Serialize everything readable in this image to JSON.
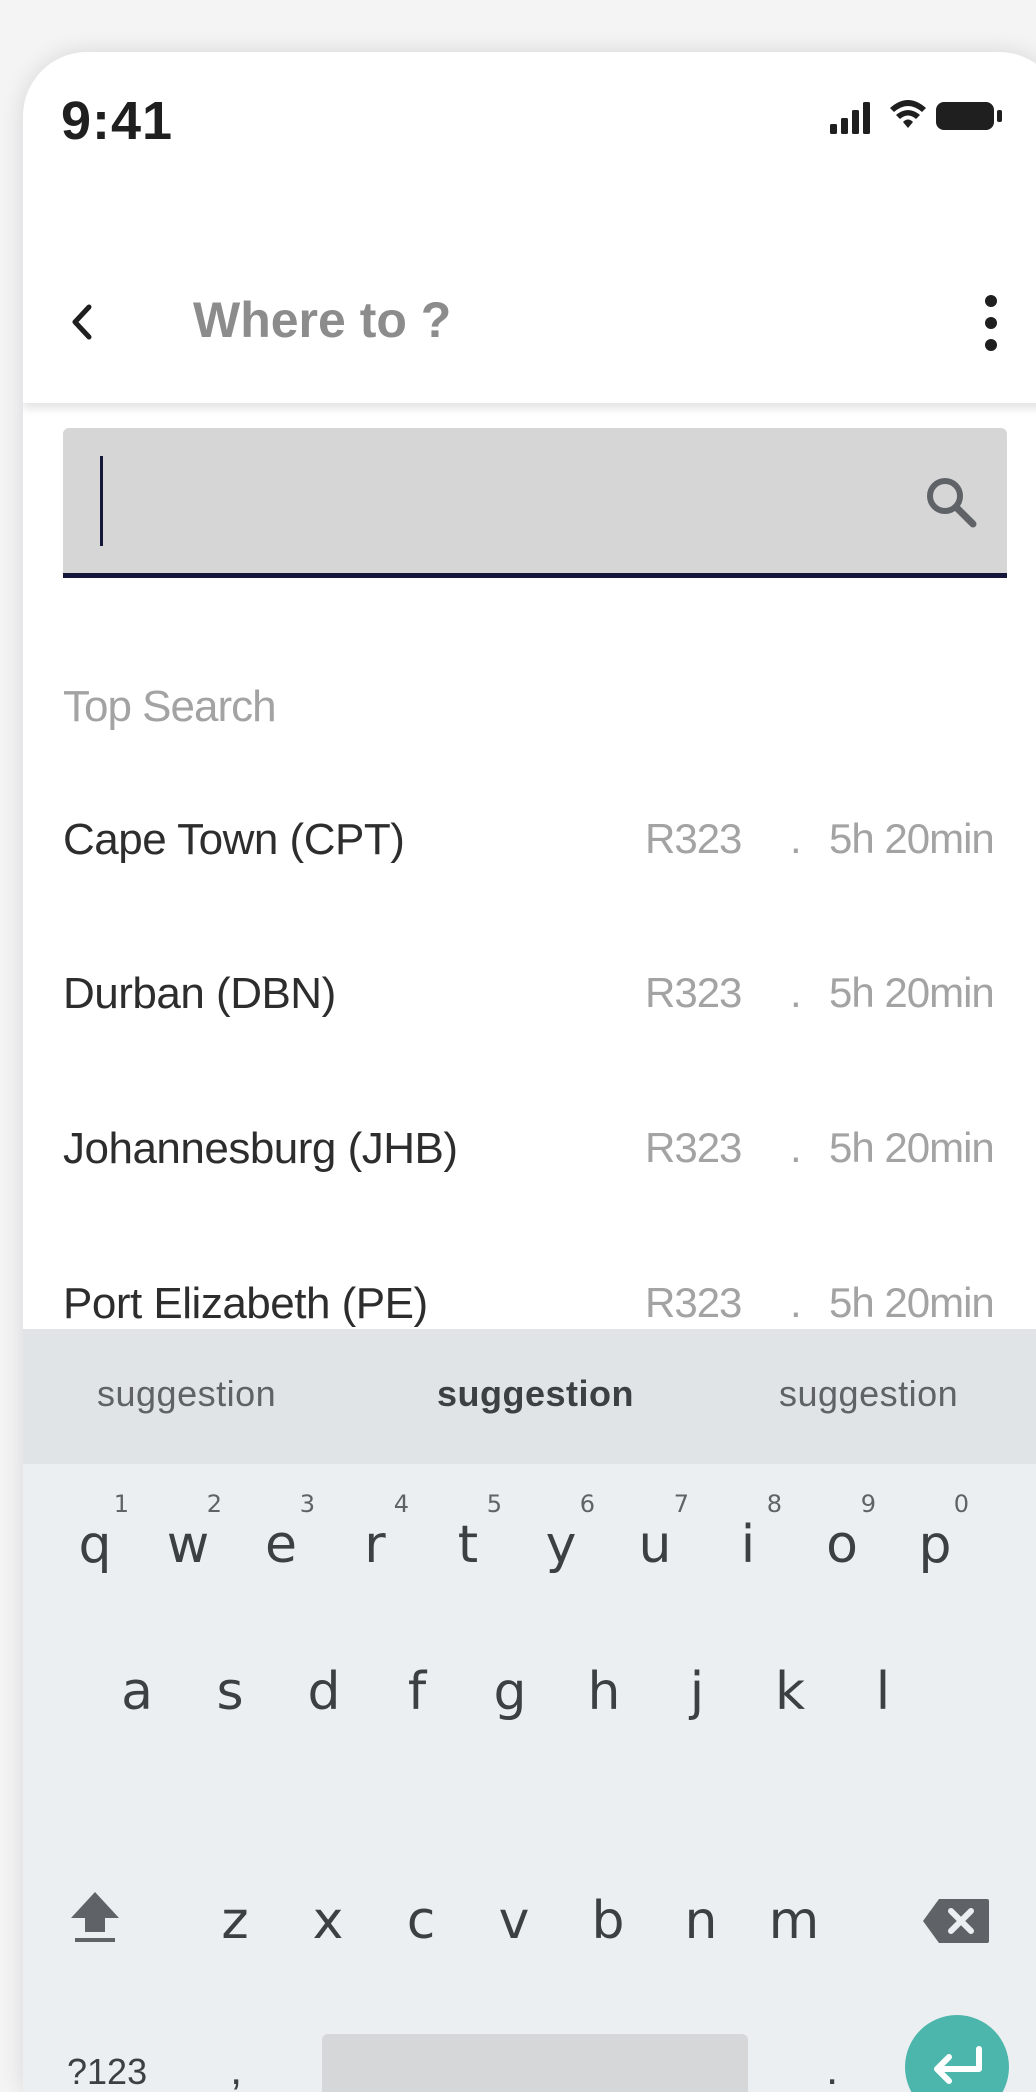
{
  "status_bar": {
    "time": "9:41"
  },
  "app_bar": {
    "title": "Where to ?"
  },
  "search": {
    "value": "",
    "placeholder": ""
  },
  "section_label": "Top Search",
  "results": [
    {
      "name": "Cape Town (CPT)",
      "price": "R323",
      "separator": ".",
      "duration": "5h 20min"
    },
    {
      "name": "Durban (DBN)",
      "price": "R323",
      "separator": ".",
      "duration": "5h 20min"
    },
    {
      "name": "Johannesburg (JHB)",
      "price": "R323",
      "separator": ".",
      "duration": "5h 20min"
    },
    {
      "name": "Port Elizabeth (PE)",
      "price": "R323",
      "separator": ".",
      "duration": "5h 20min"
    }
  ],
  "keyboard": {
    "suggestions": [
      "suggestion",
      "suggestion",
      "suggestion"
    ],
    "row1": [
      "q",
      "w",
      "e",
      "r",
      "t",
      "y",
      "u",
      "i",
      "o",
      "p"
    ],
    "row1_numbers": [
      "1",
      "2",
      "3",
      "4",
      "5",
      "6",
      "7",
      "8",
      "9",
      "0"
    ],
    "row2": [
      "a",
      "s",
      "d",
      "f",
      "g",
      "h",
      "j",
      "k",
      "l"
    ],
    "row3": [
      "z",
      "x",
      "c",
      "v",
      "b",
      "n",
      "m"
    ],
    "symbols_label": "?123",
    "comma": ",",
    "period": "."
  },
  "colors": {
    "accent": "#14163a",
    "enter_button": "#4db6ac",
    "search_bg": "#d6d6d6",
    "keyboard_bg": "#eceff1"
  }
}
